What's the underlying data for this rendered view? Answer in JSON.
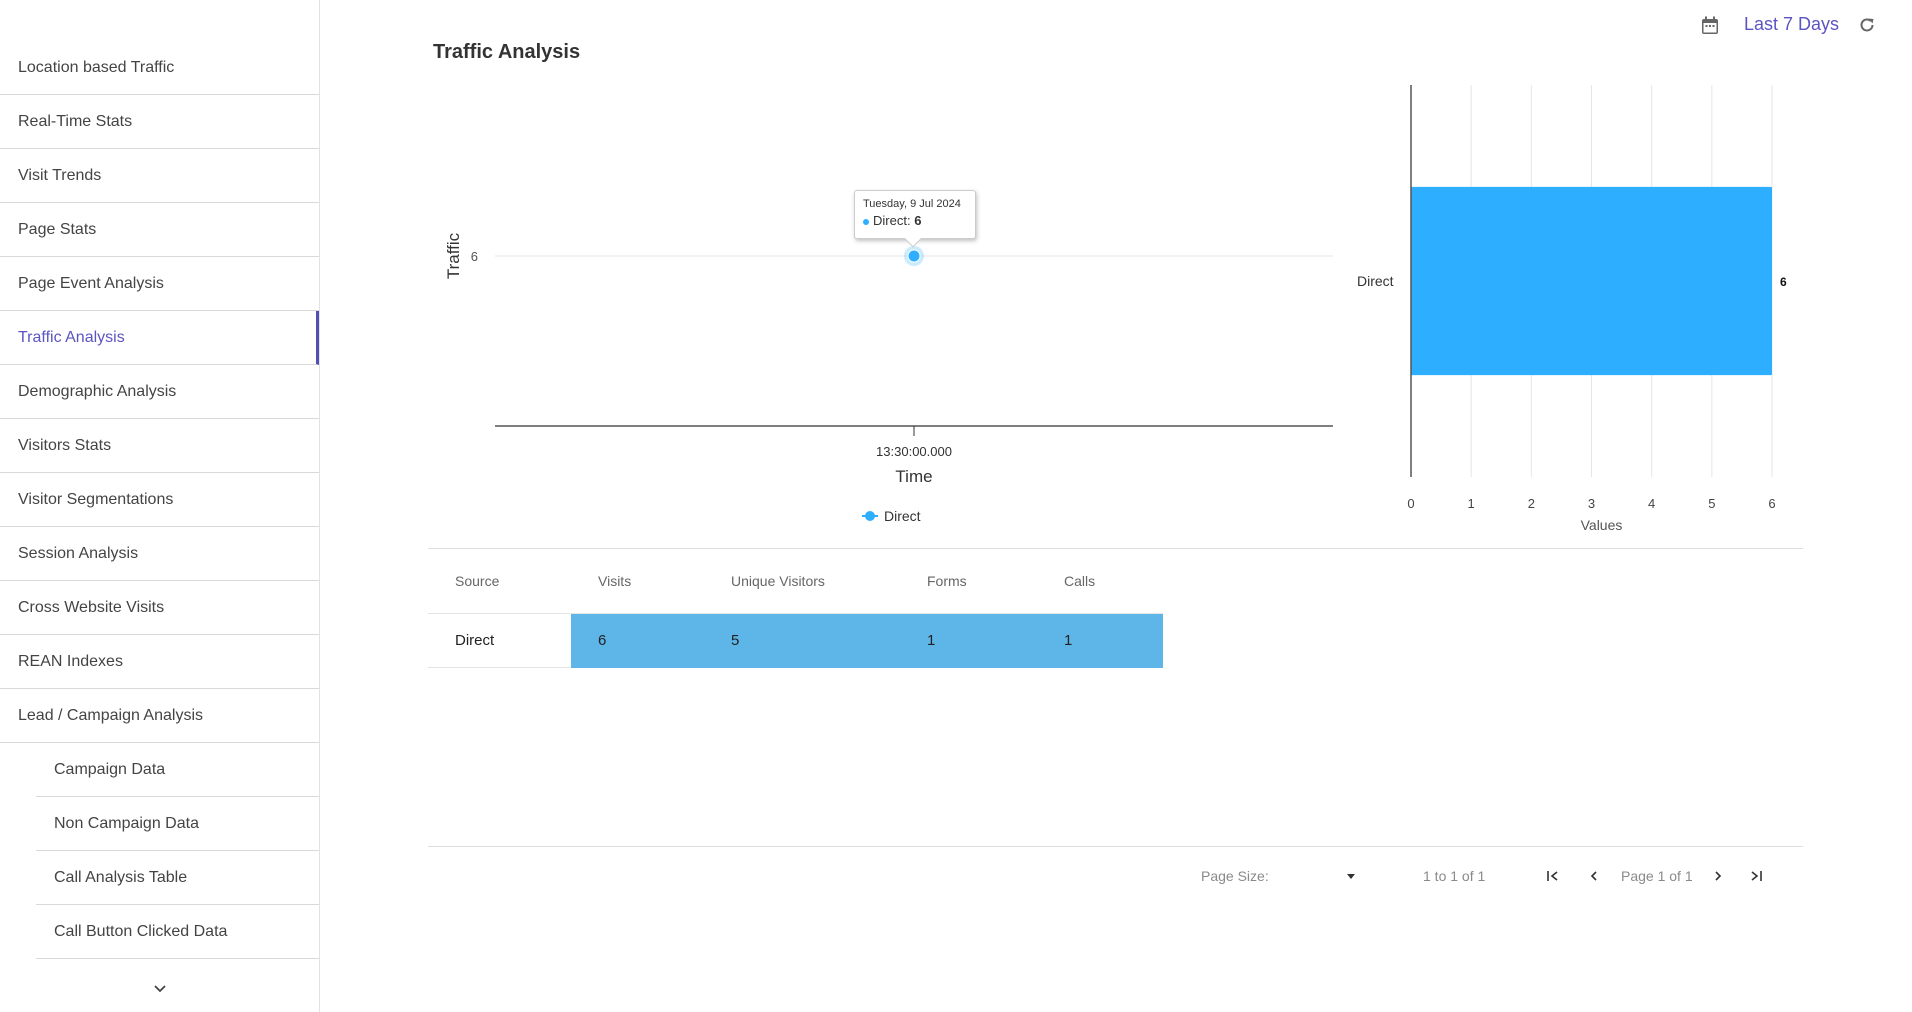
{
  "sidebar": {
    "items": [
      {
        "label": "Location based Traffic",
        "active": false,
        "sub": false
      },
      {
        "label": "Real-Time Stats",
        "active": false,
        "sub": false
      },
      {
        "label": "Visit Trends",
        "active": false,
        "sub": false
      },
      {
        "label": "Page Stats",
        "active": false,
        "sub": false
      },
      {
        "label": "Page Event Analysis",
        "active": false,
        "sub": false
      },
      {
        "label": "Traffic Analysis",
        "active": true,
        "sub": false
      },
      {
        "label": "Demographic Analysis",
        "active": false,
        "sub": false
      },
      {
        "label": "Visitors Stats",
        "active": false,
        "sub": false
      },
      {
        "label": "Visitor Segmentations",
        "active": false,
        "sub": false
      },
      {
        "label": "Session Analysis",
        "active": false,
        "sub": false
      },
      {
        "label": "Cross Website Visits",
        "active": false,
        "sub": false
      },
      {
        "label": "REAN Indexes",
        "active": false,
        "sub": false
      },
      {
        "label": "Lead / Campaign Analysis",
        "active": false,
        "sub": false
      },
      {
        "label": "Campaign Data",
        "active": false,
        "sub": true
      },
      {
        "label": "Non Campaign Data",
        "active": false,
        "sub": true
      },
      {
        "label": "Call Analysis Table",
        "active": false,
        "sub": true
      },
      {
        "label": "Call Button Clicked Data",
        "active": false,
        "sub": true
      }
    ],
    "more_icon": "chevron-down-icon"
  },
  "header": {
    "date_range_label": "Last 7 Days",
    "calendar_icon": "calendar-icon",
    "refresh_icon": "refresh-icon"
  },
  "page": {
    "title": "Traffic Analysis"
  },
  "colors": {
    "accent": "#5b55c2",
    "series": "#2eaeff",
    "table_highlight": "#5db5e8"
  },
  "chart_data": [
    {
      "type": "line",
      "title": "",
      "xlabel": "Time",
      "ylabel": "Traffic",
      "x_ticks": [
        "13:30:00.000"
      ],
      "y_ticks": [
        6
      ],
      "series": [
        {
          "name": "Direct",
          "points": [
            {
              "x": "13:30:00.000",
              "y": 6
            }
          ]
        }
      ],
      "legend": {
        "position": "bottom",
        "entries": [
          "Direct"
        ]
      },
      "tooltip": {
        "date": "Tuesday, 9 Jul 2024",
        "series": "Direct",
        "label": "Direct:",
        "value": "6"
      }
    },
    {
      "type": "bar",
      "orientation": "horizontal",
      "categories": [
        "Direct"
      ],
      "values": [
        6
      ],
      "data_labels": [
        "6"
      ],
      "xlabel": "Values",
      "ylabel": "",
      "xlim": [
        0,
        6
      ],
      "x_ticks": [
        0,
        1,
        2,
        3,
        4,
        5,
        6
      ],
      "grid": true
    }
  ],
  "table": {
    "columns": [
      "Source",
      "Visits",
      "Unique Visitors",
      "Forms",
      "Calls"
    ],
    "rows": [
      [
        "Direct",
        "6",
        "5",
        "1",
        "1"
      ]
    ]
  },
  "pagination": {
    "page_size_label": "Page Size:",
    "page_size_value": "",
    "range_text": "1 to 1 of 1",
    "page_text": "Page 1 of 1",
    "first_icon": "first-page-icon",
    "prev_icon": "prev-page-icon",
    "next_icon": "next-page-icon",
    "last_icon": "last-page-icon"
  }
}
